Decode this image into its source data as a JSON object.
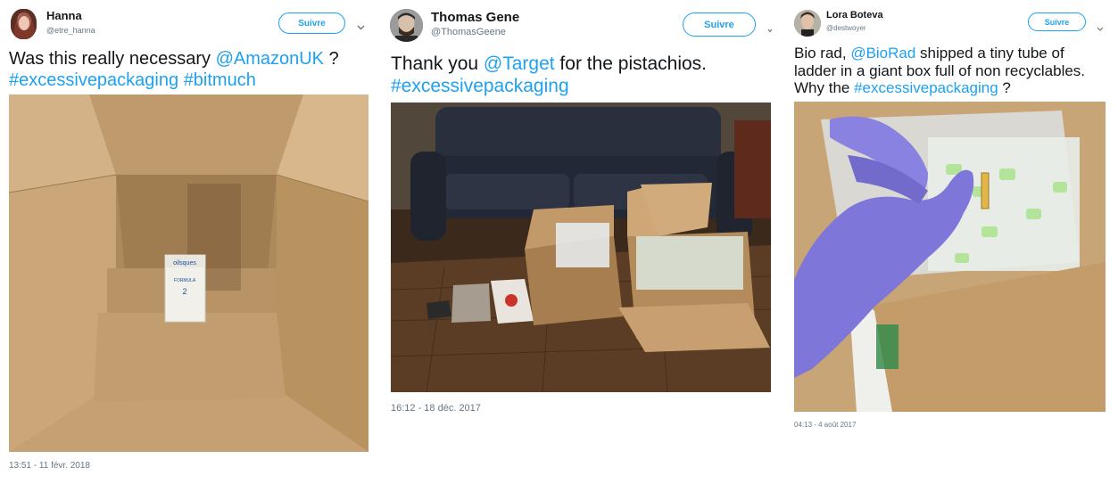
{
  "tweets": [
    {
      "name": "Hanna",
      "handle": "@etre_hanna",
      "follow_label": "Suivre",
      "chevron_icon": "chevron-down-icon",
      "text": {
        "line1_before": "Was this really necessary ",
        "mention1": "@AmazonUK",
        "line1_after": " ?",
        "hashtag1": "#excessivepackaging",
        "space": " ",
        "hashtag2": "#bitmuch"
      },
      "photo_label_brand": "oilsques",
      "photo_label_sub": "FORMULA",
      "photo_label_num": "2",
      "timestamp": "13:51 - 11 févr. 2018"
    },
    {
      "name": "Thomas Gene",
      "handle": "@ThomasGeene",
      "follow_label": "Suivre",
      "chevron_icon": "chevron-down-icon",
      "text": {
        "line1_before": "Thank you ",
        "mention1": "@Target",
        "line1_after": " for the pistachios.",
        "hashtag1": "#excessivepackaging"
      },
      "timestamp": "16:12 - 18 déc. 2017"
    },
    {
      "name": "Lora Boteva",
      "handle": "@destwoyer",
      "follow_label": "Suivre",
      "chevron_icon": "chevron-down-icon",
      "text": {
        "line1_before": "Bio rad, ",
        "mention1": "@BioRad",
        "line1_after": " shipped a tiny tube of",
        "line2": "ladder in a giant box full of non recyclables.",
        "line3_before": "Why the ",
        "hashtag1": "#excessivepackaging",
        "line3_after": " ?"
      },
      "timestamp": "04:13 - 4 août 2017"
    }
  ],
  "colors": {
    "link": "#1da1f2",
    "meta": "#657786",
    "text": "#14171a"
  }
}
